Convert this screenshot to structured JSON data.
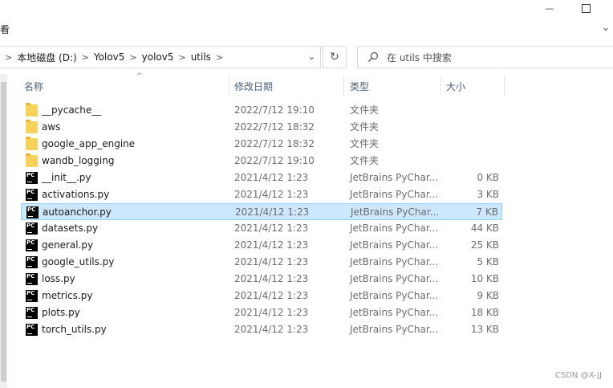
{
  "window": {
    "minimize_symbol": "—",
    "maximize_symbol": "☐"
  },
  "menu": {
    "view_label": "看",
    "expand_symbol": "⌄"
  },
  "address": {
    "crumbs": [
      "本地磁盘 (D:)",
      "Yolov5",
      "yolov5",
      "utils"
    ],
    "dropdown_symbol": "⌄",
    "refresh_symbol": "↻"
  },
  "search": {
    "placeholder": "在 utils 中搜索"
  },
  "columns": {
    "name": "名称",
    "date": "修改日期",
    "type": "类型",
    "size": "大小",
    "sort_symbol": "^"
  },
  "files": [
    {
      "icon": "folder-icon",
      "name": "__pycache__",
      "date": "2022/7/12 19:10",
      "type": "文件夹",
      "size": ""
    },
    {
      "icon": "folder-icon",
      "name": "aws",
      "date": "2022/7/12 18:32",
      "type": "文件夹",
      "size": ""
    },
    {
      "icon": "folder-icon",
      "name": "google_app_engine",
      "date": "2022/7/12 18:32",
      "type": "文件夹",
      "size": ""
    },
    {
      "icon": "folder-icon",
      "name": "wandb_logging",
      "date": "2022/7/12 19:10",
      "type": "文件夹",
      "size": ""
    },
    {
      "icon": "pycharm-file-icon",
      "name": "__init__.py",
      "date": "2021/4/12 1:23",
      "type": "JetBrains PyChar...",
      "size": "0 KB"
    },
    {
      "icon": "pycharm-file-icon",
      "name": "activations.py",
      "date": "2021/4/12 1:23",
      "type": "JetBrains PyChar...",
      "size": "3 KB"
    },
    {
      "icon": "pycharm-file-icon",
      "name": "autoanchor.py",
      "date": "2021/4/12 1:23",
      "type": "JetBrains PyChar...",
      "size": "7 KB",
      "selected": true
    },
    {
      "icon": "pycharm-file-icon",
      "name": "datasets.py",
      "date": "2021/4/12 1:23",
      "type": "JetBrains PyChar...",
      "size": "44 KB"
    },
    {
      "icon": "pycharm-file-icon",
      "name": "general.py",
      "date": "2021/4/12 1:23",
      "type": "JetBrains PyChar...",
      "size": "25 KB"
    },
    {
      "icon": "pycharm-file-icon",
      "name": "google_utils.py",
      "date": "2021/4/12 1:23",
      "type": "JetBrains PyChar...",
      "size": "5 KB"
    },
    {
      "icon": "pycharm-file-icon",
      "name": "loss.py",
      "date": "2021/4/12 1:23",
      "type": "JetBrains PyChar...",
      "size": "10 KB"
    },
    {
      "icon": "pycharm-file-icon",
      "name": "metrics.py",
      "date": "2021/4/12 1:23",
      "type": "JetBrains PyChar...",
      "size": "9 KB"
    },
    {
      "icon": "pycharm-file-icon",
      "name": "plots.py",
      "date": "2021/4/12 1:23",
      "type": "JetBrains PyChar...",
      "size": "18 KB"
    },
    {
      "icon": "pycharm-file-icon",
      "name": "torch_utils.py",
      "date": "2021/4/12 1:23",
      "type": "JetBrains PyChar...",
      "size": "13 KB"
    }
  ],
  "pycharm_icon_text": "PC",
  "watermark": "CSDN @X-JJ",
  "colors": {
    "selection_bg": "#cce8ff",
    "selection_border": "#99d1ff",
    "folder": "#f7d25a",
    "header_text": "#4c607a"
  }
}
